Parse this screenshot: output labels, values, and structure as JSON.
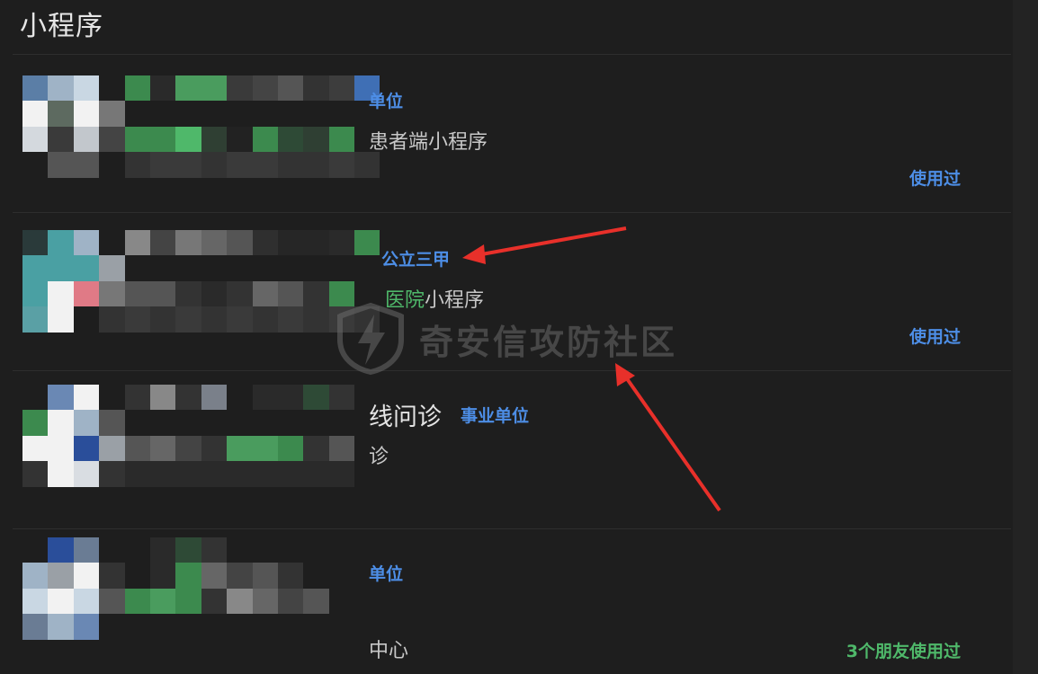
{
  "section_title": "小程序",
  "items": [
    {
      "tag": "单位",
      "subtitle": "患者端小程序",
      "used": "使用过"
    },
    {
      "tag": "公立三甲",
      "subtitle_highlight": "医院",
      "subtitle_rest": "小程序",
      "used": "使用过"
    },
    {
      "title": "线问诊",
      "tag": "事业单位",
      "subtitle": "诊",
      "used": ""
    },
    {
      "tag": "单位",
      "subtitle": "中心",
      "used": "3个朋友使用过"
    }
  ],
  "watermark": {
    "text": "奇安信攻防社区",
    "icon": "lightning-shield-icon"
  },
  "annotations": {
    "arrow_color": "#e8302a",
    "arrows": [
      "arrow-to-tag",
      "arrow-to-hospital"
    ]
  },
  "colors": {
    "link_blue": "#4d8ee6",
    "friend_green": "#4fb86a",
    "background": "#1e1e1e"
  }
}
